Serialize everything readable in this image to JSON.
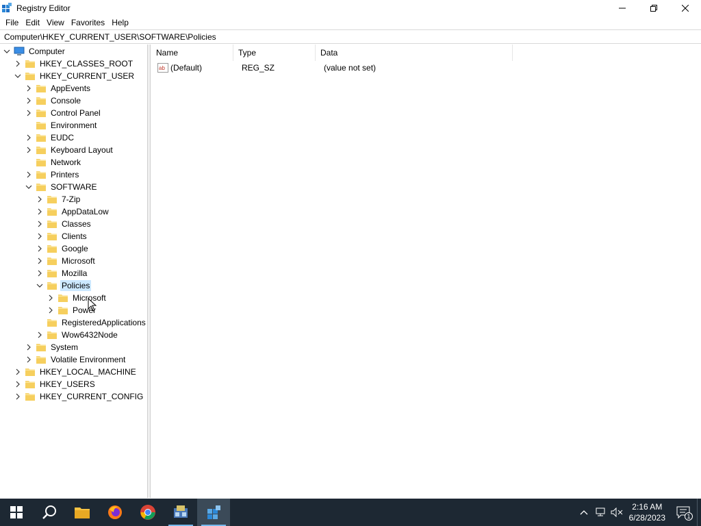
{
  "window": {
    "title": "Registry Editor",
    "icon": "registry-editor-icon"
  },
  "menu": {
    "items": [
      "File",
      "Edit",
      "View",
      "Favorites",
      "Help"
    ]
  },
  "address": {
    "path": "Computer\\HKEY_CURRENT_USER\\SOFTWARE\\Policies"
  },
  "tree": {
    "root": "Computer",
    "items": [
      {
        "label": "HKEY_CLASSES_ROOT",
        "expanded": false
      },
      {
        "label": "HKEY_CURRENT_USER",
        "expanded": true
      },
      {
        "label": "AppEvents",
        "expanded": false
      },
      {
        "label": "Console",
        "expanded": false
      },
      {
        "label": "Control Panel",
        "expanded": false
      },
      {
        "label": "Environment",
        "expanded": null
      },
      {
        "label": "EUDC",
        "expanded": false
      },
      {
        "label": "Keyboard Layout",
        "expanded": false
      },
      {
        "label": "Network",
        "expanded": null
      },
      {
        "label": "Printers",
        "expanded": false
      },
      {
        "label": "SOFTWARE",
        "expanded": true
      },
      {
        "label": "7-Zip",
        "expanded": false
      },
      {
        "label": "AppDataLow",
        "expanded": false
      },
      {
        "label": "Classes",
        "expanded": false
      },
      {
        "label": "Clients",
        "expanded": false
      },
      {
        "label": "Google",
        "expanded": false
      },
      {
        "label": "Microsoft",
        "expanded": false
      },
      {
        "label": "Mozilla",
        "expanded": false
      },
      {
        "label": "Policies",
        "expanded": true,
        "selected": true
      },
      {
        "label": "Microsoft",
        "expanded": false
      },
      {
        "label": "Power",
        "expanded": false
      },
      {
        "label": "RegisteredApplications",
        "expanded": null
      },
      {
        "label": "Wow6432Node",
        "expanded": false
      },
      {
        "label": "System",
        "expanded": false
      },
      {
        "label": "Volatile Environment",
        "expanded": false
      },
      {
        "label": "HKEY_LOCAL_MACHINE",
        "expanded": false
      },
      {
        "label": "HKEY_USERS",
        "expanded": false
      },
      {
        "label": "HKEY_CURRENT_CONFIG",
        "expanded": false
      }
    ]
  },
  "list": {
    "columns": [
      "Name",
      "Type",
      "Data"
    ],
    "rows": [
      {
        "name": "(Default)",
        "type": "REG_SZ",
        "data": "(value not set)",
        "icon": "string-value-icon"
      }
    ]
  },
  "taskbar": {
    "apps": [
      "start-button",
      "search-button",
      "file-explorer",
      "firefox",
      "chrome",
      "network-app",
      "registry-editor"
    ],
    "clock": {
      "time": "2:16 AM",
      "date": "6/28/2023"
    },
    "notification_count": "1"
  }
}
